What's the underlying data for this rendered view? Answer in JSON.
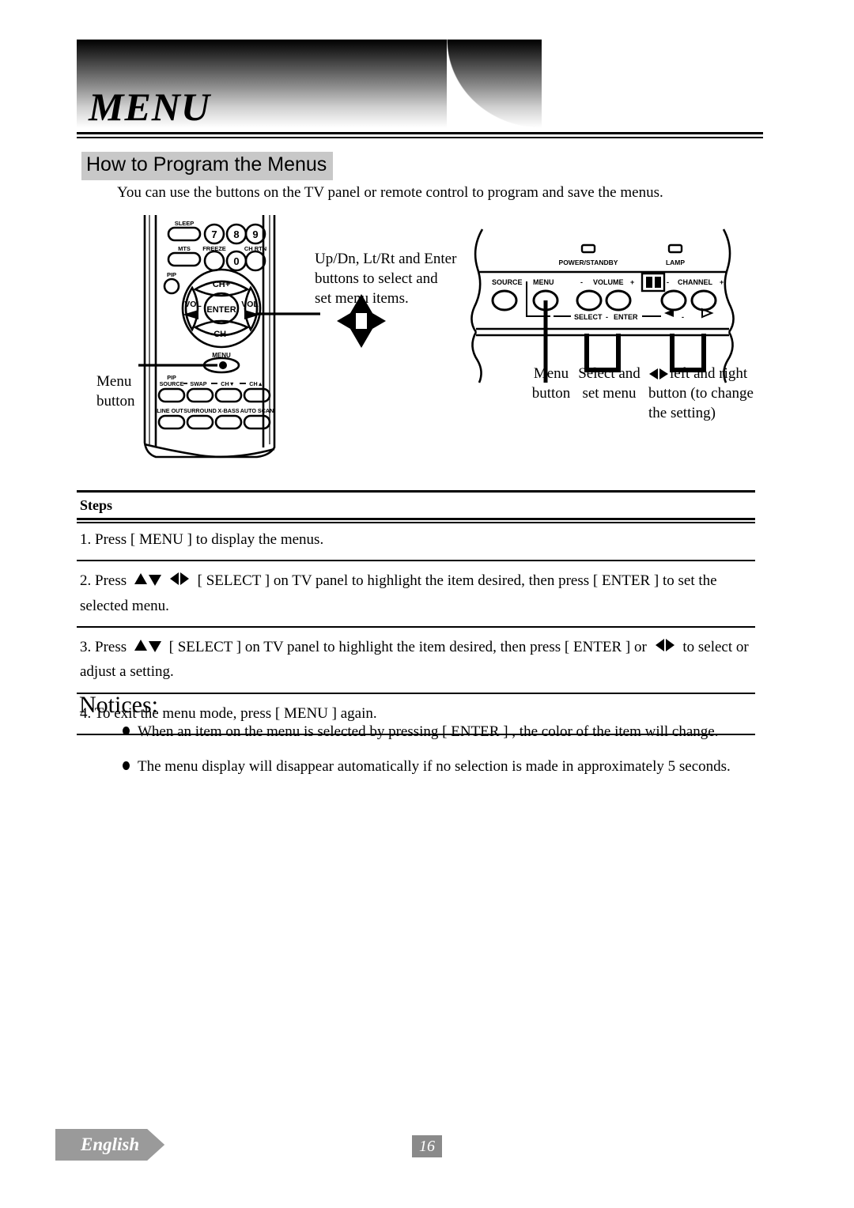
{
  "header": {
    "banner_title": "MENU",
    "section_heading": "How to Program the Menus",
    "intro": "You can use the buttons on the TV panel or remote control to program and save the menus."
  },
  "diagram": {
    "remote": {
      "alt": "remote-control",
      "top_labels": [
        "SLEEP",
        "MTS",
        "PIP"
      ],
      "keys_row1": [
        "7",
        "8",
        "9"
      ],
      "keys_row1_labels": [
        "FREEZE",
        "",
        "CH RTN"
      ],
      "keys_row2": [
        "0"
      ],
      "navpad": {
        "up": "CH+",
        "down": "CH-",
        "left": "VOL",
        "right": "VOL",
        "center": "ENTER"
      },
      "menu_label": "MENU",
      "bottom_row1": [
        "PIP SOURCE",
        "SWAP",
        "CH▼",
        "CH▲"
      ],
      "bottom_row2": [
        "LINE OUT",
        "SURROUND",
        "X-BASS",
        "AUTO SCAN"
      ]
    },
    "callouts": {
      "updn_enter": "Up/Dn, Lt/Rt and Enter buttons to select and set menu items.",
      "menu_button": "Menu button"
    },
    "tvpanel": {
      "led_power": "POWER/STANDBY",
      "led_lamp": "LAMP",
      "source": "SOURCE",
      "menu": "MENU",
      "volume_minus": "-",
      "volume": "VOLUME",
      "volume_plus": "+",
      "channel_minus": "-",
      "channel": "CHANNEL",
      "channel_plus": "+",
      "select": "SELECT",
      "select_dash": "-",
      "enter": "ENTER",
      "arrow_left": "◁",
      "arrow_dash": "-",
      "arrow_right": "▷"
    },
    "panel_labels": {
      "menu_button": "Menu button",
      "select_set_menu": "Select and set menu",
      "left_right_line1": "left and right",
      "left_right_line2": "button (to change",
      "left_right_line3": "the setting)"
    }
  },
  "steps": {
    "header": "Steps",
    "rows": [
      {
        "num": "1.",
        "parts": [
          {
            "type": "text",
            "value": "Press [ MENU ] to display the menus."
          }
        ]
      },
      {
        "num": "2.",
        "parts": [
          {
            "type": "text",
            "value": "Press "
          },
          {
            "type": "glyph",
            "value": "updown"
          },
          {
            "type": "glyph",
            "value": "leftright"
          },
          {
            "type": "text",
            "value": " [ SELECT ] on TV panel to highlight the item desired, then press [ ENTER ] to set the selected menu."
          }
        ]
      },
      {
        "num": "3.",
        "parts": [
          {
            "type": "text",
            "value": "Press "
          },
          {
            "type": "glyph",
            "value": "updown"
          },
          {
            "type": "text",
            "value": " [ SELECT ] on TV panel to highlight the item desired, then press [ ENTER ] or "
          },
          {
            "type": "glyph",
            "value": "leftright"
          },
          {
            "type": "text",
            "value": " to select or adjust a setting."
          }
        ]
      },
      {
        "num": "4.",
        "parts": [
          {
            "type": "text",
            "value": "To exit the menu mode, press [ MENU ] again."
          }
        ]
      }
    ]
  },
  "notices": {
    "title": "Notices:",
    "items": [
      "When an item on the menu is selected by pressing [ ENTER ] , the color of the item will change.",
      "The menu display will disappear automatically if no selection is made in approximately 5 seconds."
    ]
  },
  "footer": {
    "language": "English",
    "page_number": "16"
  },
  "colors": {
    "heading_highlight": "#c8c8c8",
    "footer_gray": "#9a9a9a",
    "page_badge_gray": "#8a8a8a",
    "ink": "#000000"
  }
}
